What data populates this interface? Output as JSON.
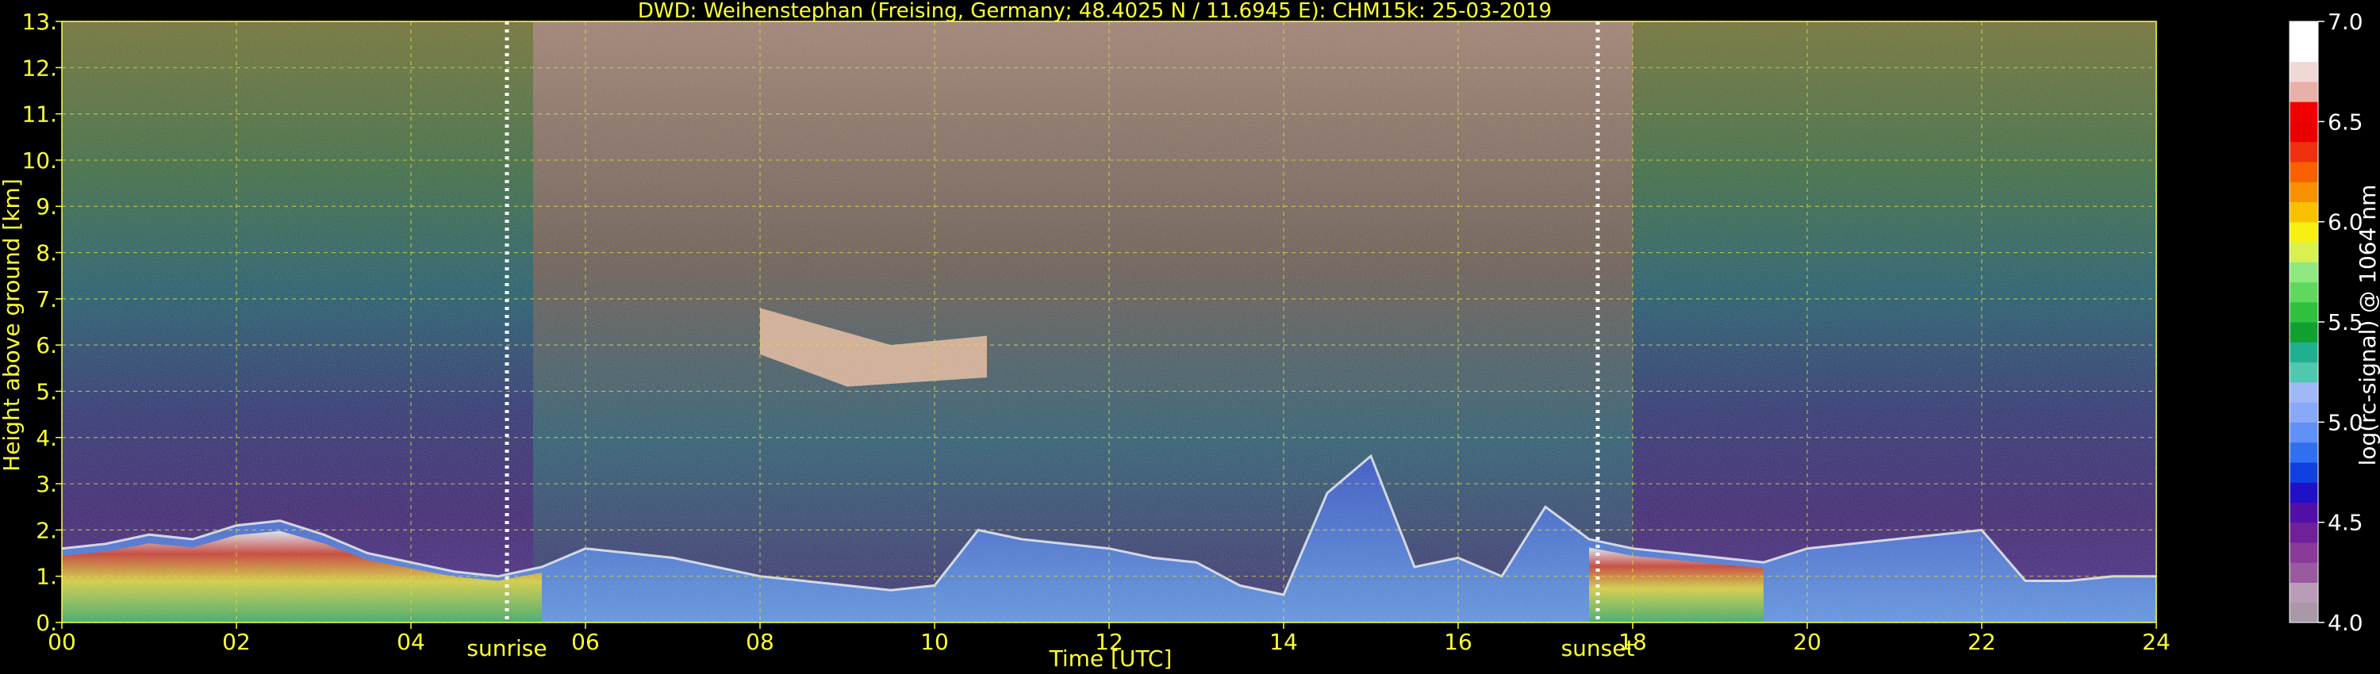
{
  "chart_data": {
    "type": "heatmap",
    "title": "DWD: Weihenstephan (Freising, Germany; 48.4025 N / 11.6945 E):    CHM15k: 25-03-2019",
    "xlabel": "Time [UTC]",
    "ylabel": "Height above ground [km]",
    "xlim": [
      0,
      24
    ],
    "ylim": [
      0,
      13
    ],
    "x_ticks": [
      0,
      2,
      4,
      6,
      8,
      10,
      12,
      14,
      16,
      18,
      20,
      22,
      24
    ],
    "x_tick_labels": [
      "00",
      "02",
      "04",
      "06",
      "08",
      "10",
      "12",
      "14",
      "16",
      "18",
      "20",
      "22",
      "24"
    ],
    "y_ticks": [
      0,
      1,
      2,
      3,
      4,
      5,
      6,
      7,
      8,
      9,
      10,
      11,
      12,
      13
    ],
    "y_tick_labels": [
      "0.",
      "1.",
      "2.",
      "3.",
      "4.",
      "5.",
      "6.",
      "7.",
      "8.",
      "9.",
      "10.",
      "11.",
      "12.",
      "13."
    ],
    "grid": true,
    "annotations": [
      {
        "label": "sunrise",
        "x": 5.1
      },
      {
        "label": "sunset",
        "x": 17.6
      }
    ],
    "colorbar": {
      "label": "log(rc-signal) @ 1064 nm",
      "range": [
        4.0,
        7.0
      ],
      "ticks": [
        4.0,
        4.5,
        5.0,
        5.5,
        6.0,
        6.5,
        7.0
      ],
      "tick_labels": [
        "4.0",
        "4.5",
        "5.0",
        "5.5",
        "6.0",
        "6.5",
        "7.0"
      ],
      "colors": [
        "#a898a8",
        "#b89cb8",
        "#9a5aa0",
        "#8a3a98",
        "#70209a",
        "#5010a8",
        "#2010c8",
        "#1040e0",
        "#3070f0",
        "#6090f8",
        "#88a8f8",
        "#a0b8f8",
        "#50c8b0",
        "#20b090",
        "#10a030",
        "#30c040",
        "#60d860",
        "#90e880",
        "#d8f050",
        "#f8f010",
        "#f8c000",
        "#f89000",
        "#f86000",
        "#f03010",
        "#e80000",
        "#f00000",
        "#e8b0a8",
        "#f0d8d8",
        "#ffffff",
        "#ffffff"
      ]
    },
    "series": [
      {
        "name": "",
        "x": [
          0,
          0.5,
          1,
          1.5,
          2,
          2.5,
          3,
          3.5,
          4,
          4.5,
          5,
          5.5,
          6,
          6.5,
          7,
          7.5,
          8,
          8.5,
          9,
          9.5,
          10,
          10.5,
          11,
          11.5,
          12,
          12.5,
          13,
          13.5,
          14,
          14.5,
          15,
          15.5,
          16,
          16.5,
          17,
          17.5,
          18,
          18.5,
          19,
          19.5,
          20,
          20.5,
          21,
          21.5,
          22,
          22.5,
          23,
          23.5,
          24
        ],
        "y": [
          1.6,
          1.7,
          1.9,
          1.8,
          2.1,
          2.2,
          1.9,
          1.5,
          1.3,
          1.1,
          1.0,
          1.2,
          1.6,
          1.5,
          1.4,
          1.2,
          1.0,
          0.9,
          0.8,
          0.7,
          0.8,
          2.0,
          1.8,
          1.7,
          1.6,
          1.4,
          1.3,
          0.8,
          0.6,
          2.8,
          3.6,
          1.2,
          1.4,
          1.0,
          2.5,
          1.8,
          1.6,
          1.5,
          1.4,
          1.3,
          1.6,
          1.7,
          1.8,
          1.9,
          2.0,
          0.9,
          0.9,
          1.0,
          1.0
        ]
      }
    ]
  }
}
